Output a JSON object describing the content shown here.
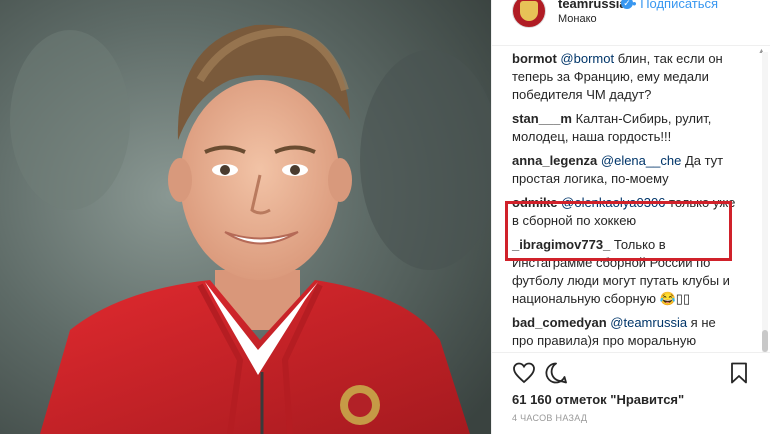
{
  "post": {
    "username": "teamrussia",
    "follow_label": "Подписаться",
    "separator": "•",
    "location": "Монако",
    "verified_mark": "✓"
  },
  "comments": [
    {
      "user": "bormot",
      "mention": "@bormot",
      "text": " блин, так если он теперь за Францию, ему медали победителя ЧМ дадут?"
    },
    {
      "user": "stan___m",
      "mention": "",
      "text": "Калтан-Сибирь, рулит, молодец, наша гордость!!!"
    },
    {
      "user": "anna_legenza",
      "mention": "@elena__che",
      "text": " Да тут простая логика, по-моему"
    },
    {
      "user": "odmike",
      "mention": "@olenkaolya0306",
      "text": " только уже в сборной по хоккею"
    },
    {
      "user": "_ibragimov773_",
      "mention": "",
      "text": "Только в Инстаграмме сборной России по футболу люди могут путать клубы и национальную сборную 😂▯▯"
    },
    {
      "user": "bad_comedyan",
      "mention": "@teamrussia",
      "text": " я не про правила)я про моральную составляющую,они поняли ,что на родине не светит ,а в России можно и основу попасть да я сборная у нас не бедная так что денег на всех хватит)и вот"
    }
  ],
  "likes": "61 160 отметок \"Нравится\"",
  "time": "4 ЧАСОВ НАЗАД",
  "icons": {
    "like": "heart-icon",
    "comment": "comment-icon",
    "save": "bookmark-icon"
  },
  "colors": {
    "highlight": "#d0212a",
    "link": "#3897f0",
    "jersey": "#d6242a"
  }
}
